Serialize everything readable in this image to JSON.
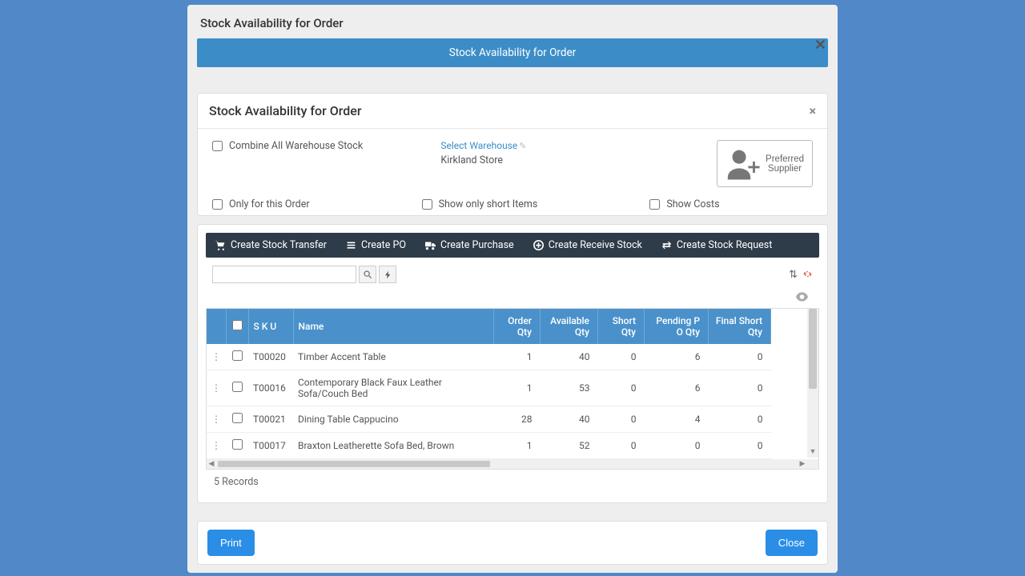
{
  "modal_title": "Stock Availability for Order",
  "banner": "Stock Availability for Order",
  "panel_title": "Stock Availability for Order",
  "filters": {
    "combine_label": "Combine All Warehouse Stock",
    "select_warehouse_link": "Select Warehouse",
    "warehouse_name": "Kirkland Store",
    "preferred_supplier": "Preferred Supplier",
    "only_this_order": "Only for this Order",
    "show_short": "Show only short Items",
    "show_costs": "Show Costs"
  },
  "toolbar": {
    "create_transfer": "Create Stock Transfer",
    "create_po": "Create PO",
    "create_purchase": "Create Purchase",
    "create_receive": "Create Receive Stock",
    "create_request": "Create Stock Request"
  },
  "columns": {
    "sku": "S K U",
    "name": "Name",
    "order_qty": "Order Qty",
    "avail_qty": "Available Qty",
    "short_qty": "Short Qty",
    "pending_po": "Pending P O Qty",
    "final_short": "Final Short Qty"
  },
  "rows": [
    {
      "sku": "T00020",
      "name": "Timber Accent Table",
      "order_qty": "1",
      "avail": "40",
      "short": "0",
      "pending": "6",
      "final": "0"
    },
    {
      "sku": "T00016",
      "name": "Contemporary Black Faux Leather Sofa/Couch Bed",
      "order_qty": "1",
      "avail": "53",
      "short": "0",
      "pending": "6",
      "final": "0"
    },
    {
      "sku": "T00021",
      "name": "Dining Table Cappucino",
      "order_qty": "28",
      "avail": "40",
      "short": "0",
      "pending": "4",
      "final": "0"
    },
    {
      "sku": "T00017",
      "name": "Braxton Leatherette Sofa Bed, Brown",
      "order_qty": "1",
      "avail": "52",
      "short": "0",
      "pending": "0",
      "final": "0"
    }
  ],
  "records_text": "5 Records",
  "footer": {
    "print": "Print",
    "close": "Close"
  }
}
